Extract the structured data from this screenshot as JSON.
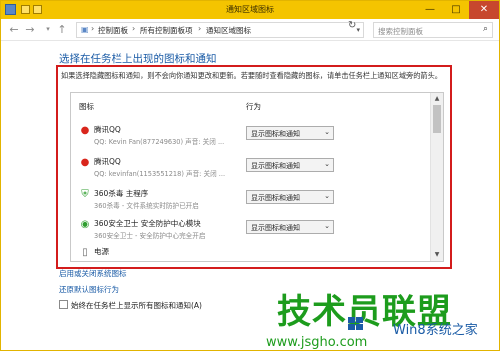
{
  "window": {
    "title": "通知区域图标"
  },
  "titlebar": {
    "minimize": "—",
    "maximize": "□",
    "close": "✕"
  },
  "nav": {
    "back": "←",
    "forward": "→",
    "up": "↑"
  },
  "address": {
    "crumbs": [
      "控制面板",
      "所有控制面板项",
      "通知区域图标"
    ]
  },
  "search": {
    "placeholder": "搜索控制面板"
  },
  "heading": "选择在任务栏上出现的图标和通知",
  "description": "如果选择隐藏图标和通知，则不会向你通知更改和更新。若要随时查看隐藏的图标，请单击任务栏上通知区域旁的箭头。",
  "table": {
    "col_icon": "图标",
    "col_behavior": "行为",
    "rows": [
      {
        "icon": "qq-icon",
        "name": "腾讯QQ",
        "sub": "QQ: Kevin Fan(877249630)  声音: 关闭 ...",
        "behavior": "显示图标和通知"
      },
      {
        "icon": "qq-icon",
        "name": "腾讯QQ",
        "sub": "QQ: kevinfan(1153551218)  声音: 关闭 ...",
        "behavior": "显示图标和通知"
      },
      {
        "icon": "shield-icon",
        "name": "360杀毒 主程序",
        "sub": "360杀毒 - 文件系统实时防护已开启",
        "behavior": "显示图标和通知"
      },
      {
        "icon": "360-safe-icon",
        "name": "360安全卫士 安全防护中心模块",
        "sub": "360安全卫士 - 安全防护中心完全开启",
        "behavior": "显示图标和通知"
      },
      {
        "icon": "power-icon",
        "name": "电源",
        "sub": "",
        "behavior": ""
      }
    ]
  },
  "links": {
    "system_icons": "启用或关闭系统图标",
    "restore": "还原默认图标行为"
  },
  "checkbox": {
    "label": "始终在任务栏上显示所有图标和通知(A)"
  },
  "watermark": {
    "main": "技术员联盟",
    "sub": "Win8系统之家",
    "url": "www.jsgho.com"
  },
  "colors": {
    "accent": "#1a5ba6",
    "highlight_box": "#d31c1c",
    "titlebar": "#f4c400"
  }
}
